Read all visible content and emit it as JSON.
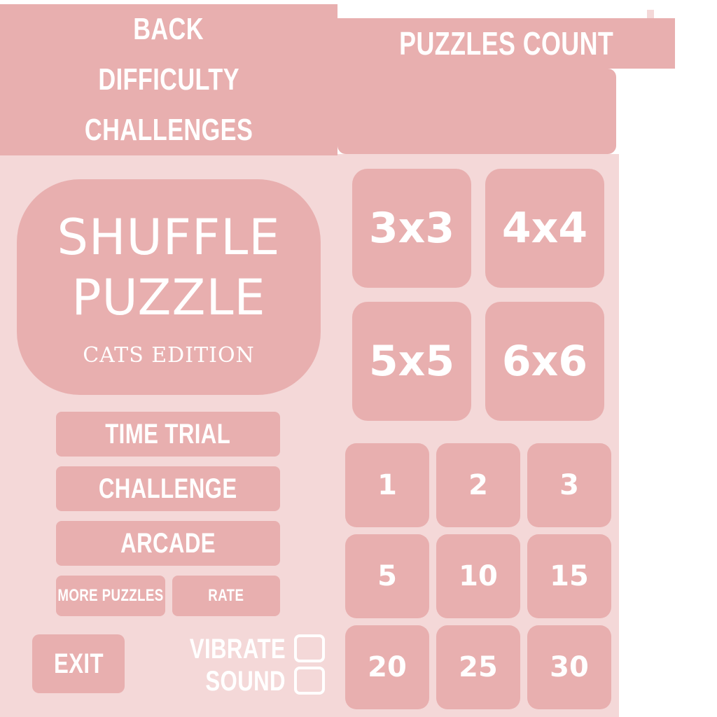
{
  "header": {
    "back_label": "BACK",
    "difficulty_label": "DIFFICULTY",
    "challenges_label": "CHALLENGES",
    "puzzles_count_label": "PUZZLES COUNT"
  },
  "title": {
    "line1": "SHUFFLE",
    "line2": "PUZZLE",
    "edition": "CATS EDITION"
  },
  "modes": {
    "time_trial": "TIME TRIAL",
    "challenge": "CHALLENGE",
    "arcade": "ARCADE",
    "more_puzzles": "MORE PUZZLES",
    "rate": "RATE"
  },
  "exit_label": "EXIT",
  "settings": {
    "vibrate_label": "VIBRATE",
    "sound_label": "SOUND",
    "vibrate_checked": false,
    "sound_checked": false
  },
  "grid_sizes": [
    "3x3",
    "4x4",
    "5x5",
    "6x6"
  ],
  "puzzle_counts": [
    "1",
    "2",
    "3",
    "5",
    "10",
    "15",
    "20",
    "25",
    "30"
  ],
  "colors": {
    "tile": "#e8afaf",
    "panel": "#f4d8d8",
    "text": "#ffffff"
  }
}
